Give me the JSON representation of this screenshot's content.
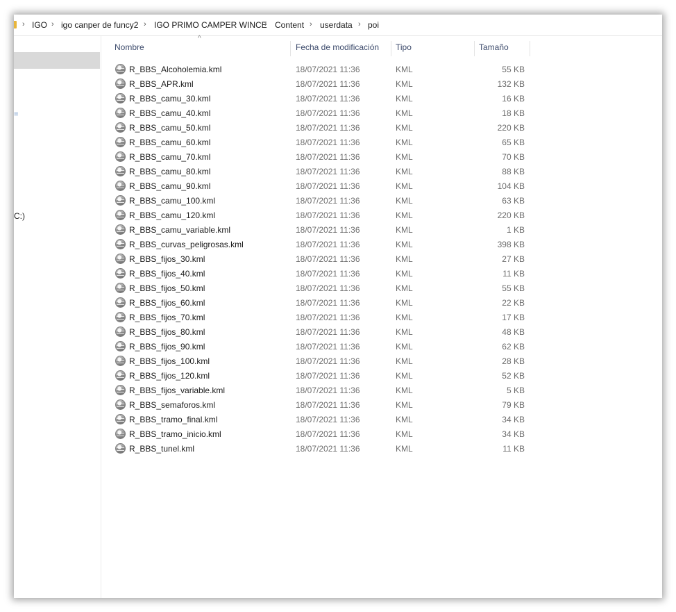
{
  "breadcrumb": {
    "items": [
      "IGO",
      "igo canper de funcy2",
      "IGO PRIMO CAMPER WINCE",
      "Content",
      "userdata",
      "poi"
    ],
    "separator": "›"
  },
  "nav": {
    "drive_label": "C:)",
    "mark": "="
  },
  "columns": {
    "sort_indicator": "^",
    "name": "Nombre",
    "date": "Fecha de modificación",
    "type": "Tipo",
    "size": "Tamaño"
  },
  "files": [
    {
      "name": "R_BBS_Alcoholemia.kml",
      "date": "18/07/2021 11:36",
      "type": "KML",
      "size": "55 KB"
    },
    {
      "name": "R_BBS_APR.kml",
      "date": "18/07/2021 11:36",
      "type": "KML",
      "size": "132 KB"
    },
    {
      "name": "R_BBS_camu_30.kml",
      "date": "18/07/2021 11:36",
      "type": "KML",
      "size": "16 KB"
    },
    {
      "name": "R_BBS_camu_40.kml",
      "date": "18/07/2021 11:36",
      "type": "KML",
      "size": "18 KB"
    },
    {
      "name": "R_BBS_camu_50.kml",
      "date": "18/07/2021 11:36",
      "type": "KML",
      "size": "220 KB"
    },
    {
      "name": "R_BBS_camu_60.kml",
      "date": "18/07/2021 11:36",
      "type": "KML",
      "size": "65 KB"
    },
    {
      "name": "R_BBS_camu_70.kml",
      "date": "18/07/2021 11:36",
      "type": "KML",
      "size": "70 KB"
    },
    {
      "name": "R_BBS_camu_80.kml",
      "date": "18/07/2021 11:36",
      "type": "KML",
      "size": "88 KB"
    },
    {
      "name": "R_BBS_camu_90.kml",
      "date": "18/07/2021 11:36",
      "type": "KML",
      "size": "104 KB"
    },
    {
      "name": "R_BBS_camu_100.kml",
      "date": "18/07/2021 11:36",
      "type": "KML",
      "size": "63 KB"
    },
    {
      "name": "R_BBS_camu_120.kml",
      "date": "18/07/2021 11:36",
      "type": "KML",
      "size": "220 KB"
    },
    {
      "name": "R_BBS_camu_variable.kml",
      "date": "18/07/2021 11:36",
      "type": "KML",
      "size": "1 KB"
    },
    {
      "name": "R_BBS_curvas_peligrosas.kml",
      "date": "18/07/2021 11:36",
      "type": "KML",
      "size": "398 KB"
    },
    {
      "name": "R_BBS_fijos_30.kml",
      "date": "18/07/2021 11:36",
      "type": "KML",
      "size": "27 KB"
    },
    {
      "name": "R_BBS_fijos_40.kml",
      "date": "18/07/2021 11:36",
      "type": "KML",
      "size": "11 KB"
    },
    {
      "name": "R_BBS_fijos_50.kml",
      "date": "18/07/2021 11:36",
      "type": "KML",
      "size": "55 KB"
    },
    {
      "name": "R_BBS_fijos_60.kml",
      "date": "18/07/2021 11:36",
      "type": "KML",
      "size": "22 KB"
    },
    {
      "name": "R_BBS_fijos_70.kml",
      "date": "18/07/2021 11:36",
      "type": "KML",
      "size": "17 KB"
    },
    {
      "name": "R_BBS_fijos_80.kml",
      "date": "18/07/2021 11:36",
      "type": "KML",
      "size": "48 KB"
    },
    {
      "name": "R_BBS_fijos_90.kml",
      "date": "18/07/2021 11:36",
      "type": "KML",
      "size": "62 KB"
    },
    {
      "name": "R_BBS_fijos_100.kml",
      "date": "18/07/2021 11:36",
      "type": "KML",
      "size": "28 KB"
    },
    {
      "name": "R_BBS_fijos_120.kml",
      "date": "18/07/2021 11:36",
      "type": "KML",
      "size": "52 KB"
    },
    {
      "name": "R_BBS_fijos_variable.kml",
      "date": "18/07/2021 11:36",
      "type": "KML",
      "size": "5 KB"
    },
    {
      "name": "R_BBS_semaforos.kml",
      "date": "18/07/2021 11:36",
      "type": "KML",
      "size": "79 KB"
    },
    {
      "name": "R_BBS_tramo_final.kml",
      "date": "18/07/2021 11:36",
      "type": "KML",
      "size": "34 KB"
    },
    {
      "name": "R_BBS_tramo_inicio.kml",
      "date": "18/07/2021 11:36",
      "type": "KML",
      "size": "34 KB"
    },
    {
      "name": "R_BBS_tunel.kml",
      "date": "18/07/2021 11:36",
      "type": "KML",
      "size": "11 KB"
    }
  ]
}
